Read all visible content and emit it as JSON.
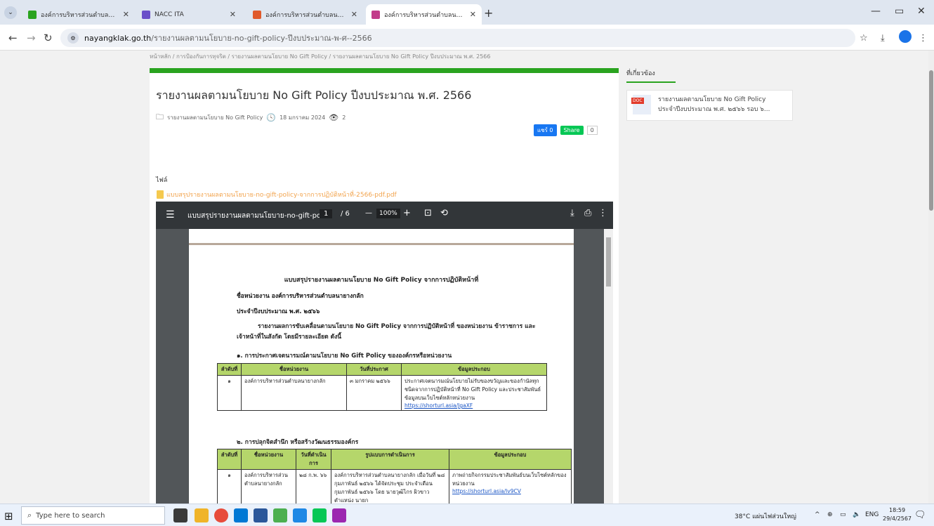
{
  "tabs": [
    {
      "title": "องค์การบริหารส่วนตำบลนายางกลัก",
      "active": false,
      "color": "#2aa31f"
    },
    {
      "title": "NACC ITA",
      "active": false,
      "color": "#6a4fc9"
    },
    {
      "title": "องค์การบริหารส่วนตำบลนายางกลัก",
      "active": false,
      "color": "#e05a2b"
    },
    {
      "title": "องค์การบริหารส่วนตำบลนายางกลัก",
      "active": true,
      "color": "#c23b8a"
    }
  ],
  "url": {
    "host": "nayangklak.go.th",
    "path": "/รายงานผลตามนโยบาย-no-gift-policy-ปีงบประมาณ-พ-ศ--2566"
  },
  "breadcrumb": "หน้าหลัก / การป้องกันการทุจริต / รายงานผลตามนโยบาย No Gift Policy / รายงานผลตามนโยบาย No Gift Policy ปีงบประมาณ พ.ศ. 2566",
  "article": {
    "title": "รายงานผลตามนโยบาย No Gift Policy ปีงบประมาณ พ.ศ. 2566",
    "category": "รายงานผลตามนโยบาย No Gift Policy",
    "date": "18 มกราคม 2024",
    "views": "2",
    "fb_share": "แชร์ 0",
    "line_share": "Share",
    "share_count": "0",
    "files_label": "ไฟล์",
    "file_name": "แบบสรุปรายงานผลตามนโยบาย-no-gift-policy-จากการปฏิบัติหน้าที่-2566-pdf.pdf"
  },
  "sidebar": {
    "title": "ที่เกี่ยวข้อง",
    "item_line1": "รายงานผลตามนโยบาย No Gift Policy",
    "item_line2": "ประจำปีงบประมาณ พ.ศ. ๒๕๖๖ รอบ ๖...",
    "doc_label": "DOC"
  },
  "pdf": {
    "filename": "แบบสรุปรายงานผลตามนโยบาย-no-gift-poli...",
    "page": "1",
    "pages": "/ 6",
    "zoom": "100%",
    "doc_title": "แบบสรุปรายงานผลตามนโยบาย No Gift Policy จากการปฏิบัติหน้าที่",
    "agency": "ชื่อหน่วยงาน องค์การบริหารส่วนตำบลนายางกลัก",
    "fiscal": "ประจำปีงบประมาณ พ.ศ. ๒๕๖๖",
    "intro": "รายงานผลการขับเคลื่อนตามนโยบาย No Gift Policy จากการปฏิบัติหน้าที่ ของหน่วยงาน ข้าราชการ และเจ้าหน้าที่ในสังกัด โดยมีรายละเอียด ดังนี้",
    "section1": "๑. การประกาศเจตนารมณ์ตามนโยบาย No Gift Policy ขององค์กรหรือหน่วยงาน",
    "t1_headers": [
      "ลำดับที่",
      "ชื่อหน่วยงาน",
      "วันที่ประกาศ",
      "ข้อมูลประกอบ"
    ],
    "t1_row": [
      "๑",
      "องค์การบริหารส่วนตำบลนายางกลัก",
      "๓ มกราคม ๒๕๖๖",
      "ประกาศเจตนารมณ์นโยบายไม่รับของขวัญและของกำนัลทุกชนิดจากการปฏิบัติหน้าที่ No Gift Policy และประชาสัมพันธ์ข้อมูลบนเว็บไซต์หลักหน่วยงาน"
    ],
    "t1_link": "https://shorturl.asia/JgaXF",
    "section2": "๒. การปลุกจิตสำนึก หรือสร้างวัฒนธรรมองค์กร",
    "t2_headers": [
      "ลำดับที่",
      "ชื่อหน่วยงาน",
      "วันที่ดำเนินการ",
      "รูปแบบการดำเนินการ",
      "ข้อมูลประกอบ"
    ],
    "t2_row": [
      "๑",
      "องค์การบริหารส่วนตำบลนายางกลัก",
      "๒๘ ก.พ. ๖๖",
      "องค์การบริหารส่วนตำบลนายางกลัก เมื่อวันที่ ๒๘ กุมภาพันธ์ ๒๕๖๖ ได้จัดประชุม ประจำเดือน กุมภาพันธ์ ๒๕๖๖ โดย นายวุฒิไกร ผิวขาว ตำแหน่ง นายก",
      "ภาพถ่ายกิจกรรมประชาสัมพันธ์บนเว็บไซต์หลักของหน่วยงาน"
    ],
    "t2_link": "https://shorturl.asia/lv9CV"
  },
  "taskbar": {
    "search_placeholder": "Type here to search",
    "weather": "38°C แผ่นไฟส่วนใหญ่",
    "lang": "ENG",
    "time": "18:59",
    "date": "29/4/2567"
  }
}
